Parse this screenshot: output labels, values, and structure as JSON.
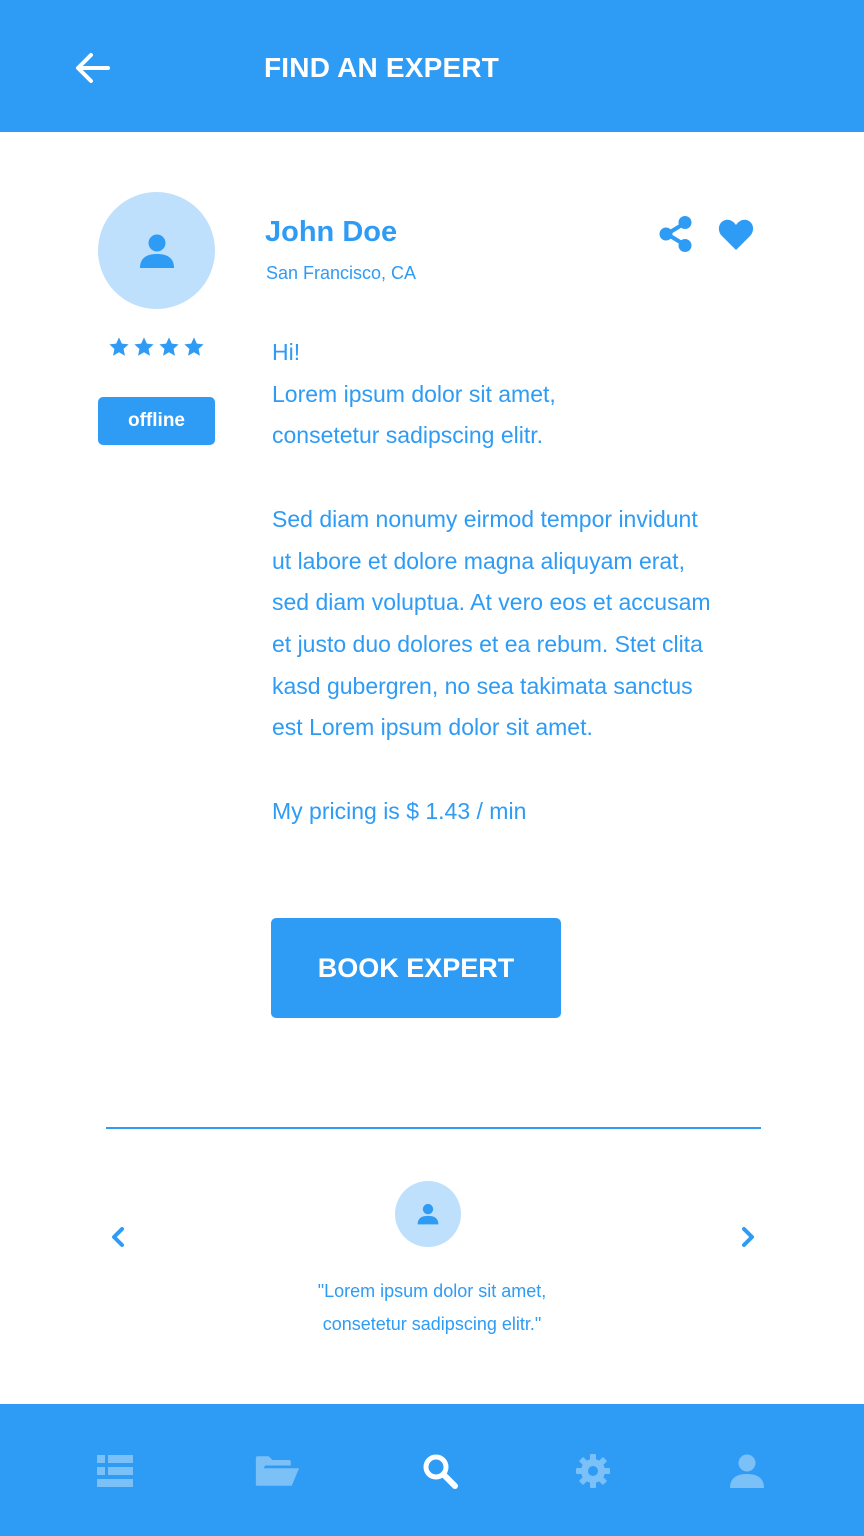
{
  "header": {
    "title": "FIND AN EXPERT",
    "back_icon": "arrow-left-icon"
  },
  "colors": {
    "primary": "#2e9bf5",
    "avatar_bg": "#bfe0fc",
    "inactive_nav_icon": "#7cc0f8",
    "background": "#ffffff"
  },
  "expert": {
    "name": "John Doe",
    "location": "San Francisco, CA",
    "rating": 4,
    "rating_max": 4,
    "status": "offline",
    "bio": {
      "greeting": "Hi!",
      "line1": "Lorem ipsum dolor sit amet,",
      "line2": "consetetur sadipscing elitr.",
      "para2": [
        "Sed diam nonumy eirmod tempor invidunt",
        "ut labore et dolore magna aliquyam erat,",
        "sed diam voluptua. At vero eos et accusam",
        "et justo duo dolores et ea rebum. Stet clita",
        "kasd gubergren, no sea takimata sanctus",
        "est Lorem ipsum dolor sit amet."
      ],
      "pricing": "My pricing is $ 1.43 / min"
    },
    "actions": {
      "share_icon": "share-icon",
      "favorite_icon": "heart-icon"
    }
  },
  "book_button": {
    "label": "BOOK EXPERT"
  },
  "testimonial": {
    "line1": "\"Lorem ipsum dolor sit amet,",
    "line2": "consetetur sadipscing elitr.\"",
    "prev_icon": "chevron-left-icon",
    "next_icon": "chevron-right-icon"
  },
  "bottom_nav": {
    "items": [
      {
        "icon": "dashboard-icon",
        "active": false
      },
      {
        "icon": "folder-icon",
        "active": false
      },
      {
        "icon": "search-icon",
        "active": true
      },
      {
        "icon": "gear-icon",
        "active": false
      },
      {
        "icon": "user-icon",
        "active": false
      }
    ]
  }
}
